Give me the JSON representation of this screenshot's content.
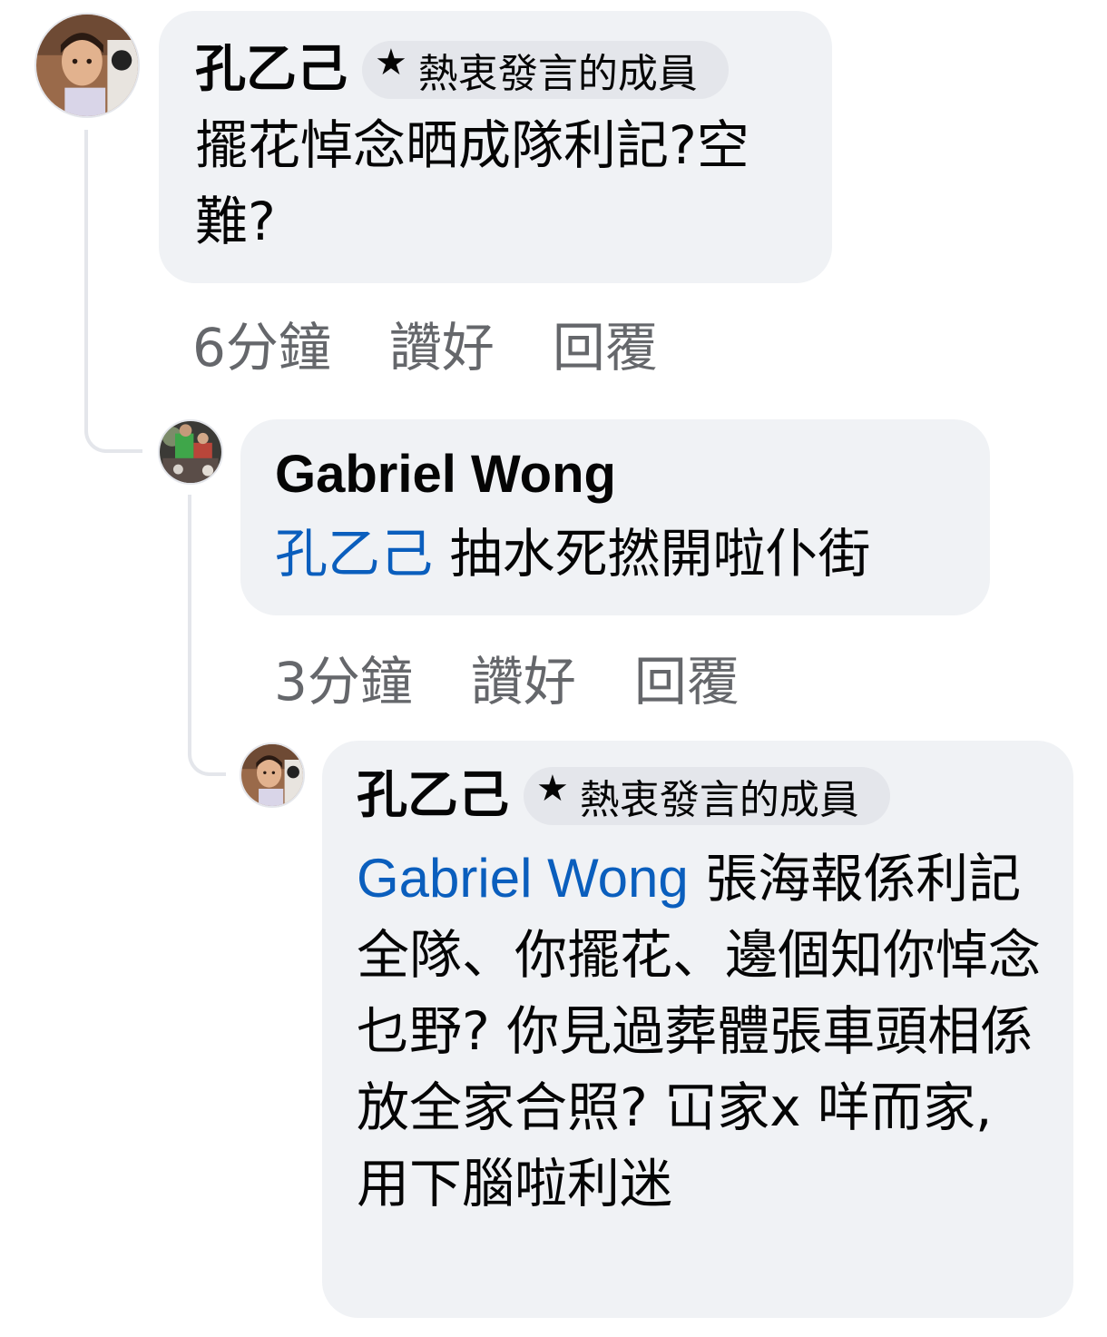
{
  "comments": [
    {
      "author": "孔乙己",
      "badge": "熱衷發言的成員",
      "text": "擺花悼念晒成隊利記?空難?",
      "time": "6分鐘",
      "like_label": "讚好",
      "reply_label": "回覆"
    },
    {
      "author": "Gabriel Wong",
      "mention": "孔乙己",
      "text": "抽水死撚開啦仆街",
      "time": "3分鐘",
      "like_label": "讚好",
      "reply_label": "回覆"
    },
    {
      "author": "孔乙己",
      "badge": "熱衷發言的成員",
      "mention": "Gabriel Wong",
      "text": "張海報係利記全隊、你擺花、邊個知你悼念乜野? 你見過葬體張車頭相係放全家合照? 冚家x 咩而家, 用下腦啦利迷"
    }
  ],
  "icons": {
    "badge": "star-icon",
    "avatar_1": "avatar-photo-child",
    "avatar_2": "avatar-photo-crowd",
    "avatar_3": "avatar-photo-child"
  },
  "colors": {
    "bubble": "#f0f2f5",
    "badge": "#e4e6eb",
    "mention": "#0a5ebd",
    "meta": "#65676b",
    "thread_line": "#e4e6eb"
  }
}
